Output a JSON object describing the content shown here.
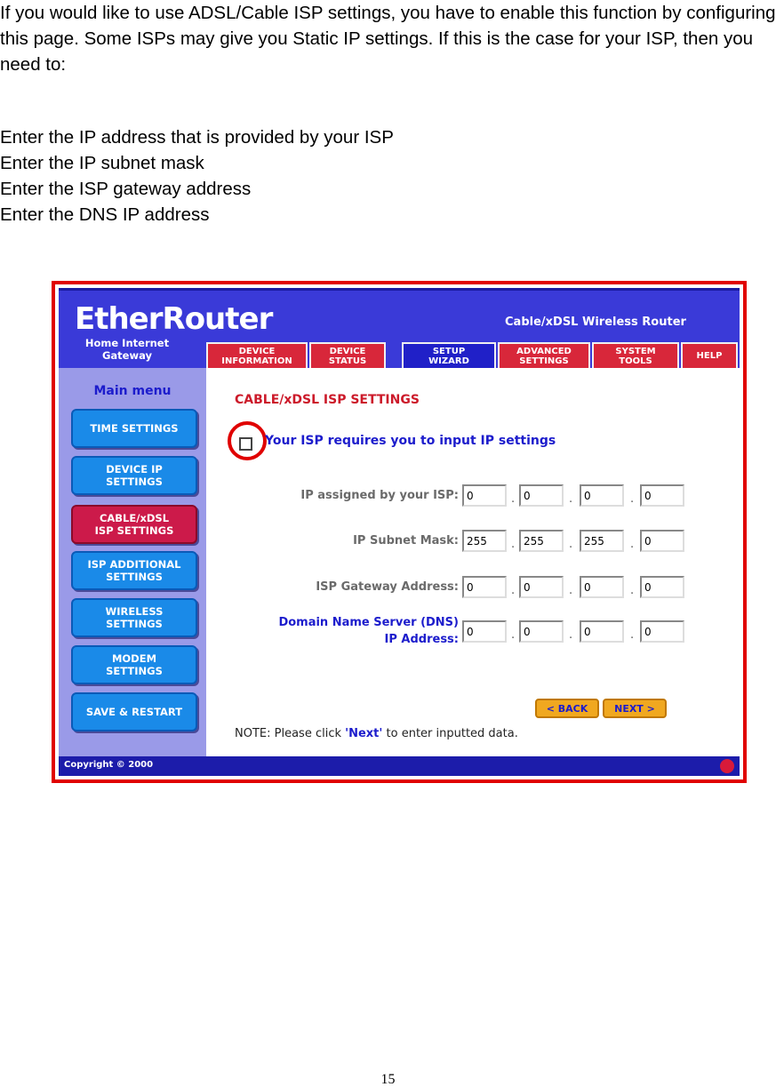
{
  "intro": "If you would like to use ADSL/Cable ISP settings, you have to enable this function by configuring this page. Some ISPs may give you Static IP settings. If this is the case for your ISP, then you need to:",
  "steps": [
    "Enter the IP address that is provided by your ISP",
    "Enter the IP subnet mask",
    "Enter the ISP gateway address",
    "Enter the DNS IP address"
  ],
  "router": {
    "brand": "EtherRouter",
    "tagline": "Cable/xDSL Wireless Router",
    "subtitle_1": "Home Internet",
    "subtitle_2": "Gateway",
    "tabs": [
      {
        "line1": "DEVICE",
        "line2": "INFORMATION"
      },
      {
        "line1": "DEVICE",
        "line2": "STATUS"
      },
      {
        "line1": "SETUP",
        "line2": "WIZARD"
      },
      {
        "line1": "ADVANCED",
        "line2": "SETTINGS"
      },
      {
        "line1": "SYSTEM",
        "line2": "TOOLS"
      },
      {
        "line1": "HELP",
        "line2": ""
      }
    ],
    "menu_title": "Main menu",
    "menu": [
      {
        "line1": "TIME SETTINGS",
        "line2": ""
      },
      {
        "line1": "DEVICE IP",
        "line2": "SETTINGS"
      },
      {
        "line1": "CABLE/xDSL",
        "line2": "ISP SETTINGS"
      },
      {
        "line1": "ISP ADDITIONAL",
        "line2": "SETTINGS"
      },
      {
        "line1": "WIRELESS",
        "line2": "SETTINGS"
      },
      {
        "line1": "MODEM",
        "line2": "SETTINGS"
      },
      {
        "line1": "SAVE & RESTART",
        "line2": ""
      }
    ],
    "section_title": "CABLE/xDSL ISP SETTINGS",
    "checkbox_label": "Your ISP requires you to input IP settings",
    "fields": {
      "ip": {
        "label": "IP assigned by your ISP:",
        "values": [
          "0",
          "0",
          "0",
          "0"
        ]
      },
      "mask": {
        "label": "IP Subnet Mask:",
        "values": [
          "255",
          "255",
          "255",
          "0"
        ]
      },
      "gateway": {
        "label": "ISP Gateway Address:",
        "values": [
          "0",
          "0",
          "0",
          "0"
        ]
      },
      "dns": {
        "label_1": "Domain Name Server (DNS)",
        "label_2": "IP Address:",
        "values": [
          "0",
          "0",
          "0",
          "0"
        ]
      }
    },
    "back_label": "< BACK",
    "next_label": "NEXT >",
    "note_prefix": "NOTE: Please click ",
    "note_link": "'Next'",
    "note_suffix": " to enter inputted data.",
    "copyright": "Copyright © 2000"
  },
  "page_number": "15"
}
